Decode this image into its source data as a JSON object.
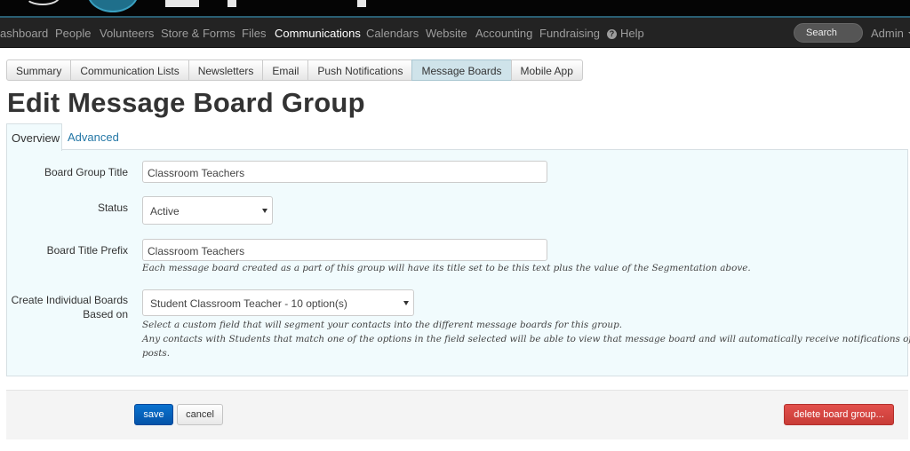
{
  "nav": {
    "items": [
      "ashboard",
      "People",
      "Volunteers",
      "Store & Forms",
      "Files",
      "Communications",
      "Calendars",
      "Website",
      "Accounting",
      "Fundraising"
    ],
    "help_label": "Help",
    "search_label": "Search",
    "admin_label": "Admin"
  },
  "subnav": {
    "tabs": [
      "Summary",
      "Communication Lists",
      "Newsletters",
      "Email",
      "Push Notifications",
      "Message Boards",
      "Mobile App"
    ],
    "active": "Message Boards"
  },
  "page": {
    "title": "Edit Message Board Group"
  },
  "form_tabs": {
    "overview": "Overview",
    "advanced": "Advanced"
  },
  "form": {
    "board_group_title": {
      "label": "Board Group Title",
      "value": "Classroom Teachers"
    },
    "status": {
      "label": "Status",
      "value": "Active"
    },
    "board_title_prefix": {
      "label": "Board Title Prefix",
      "value": "Classroom Teachers",
      "help": "Each message board created as a part of this group will have its title set to be this text plus the value of the Segmentation above."
    },
    "segmentation": {
      "label_line1": "Create Individual Boards",
      "label_line2": "Based on",
      "value": "Student Classroom Teacher - 10 option(s)",
      "help_line1": "Select a custom field that will segment your contacts into the different message boards for this group.",
      "help_line2": "Any contacts with Students that match one of the options in the field selected will be able to view that message board and will automatically receive notifications of new",
      "help_line3": "posts."
    }
  },
  "actions": {
    "save": "save",
    "cancel": "cancel",
    "delete": "delete board group..."
  },
  "colors": {
    "nav_bg": "#232323",
    "accent": "#2477a6",
    "panel_bg": "#f1fbfd",
    "save": "#0a5fbf",
    "delete": "#d9443f"
  }
}
